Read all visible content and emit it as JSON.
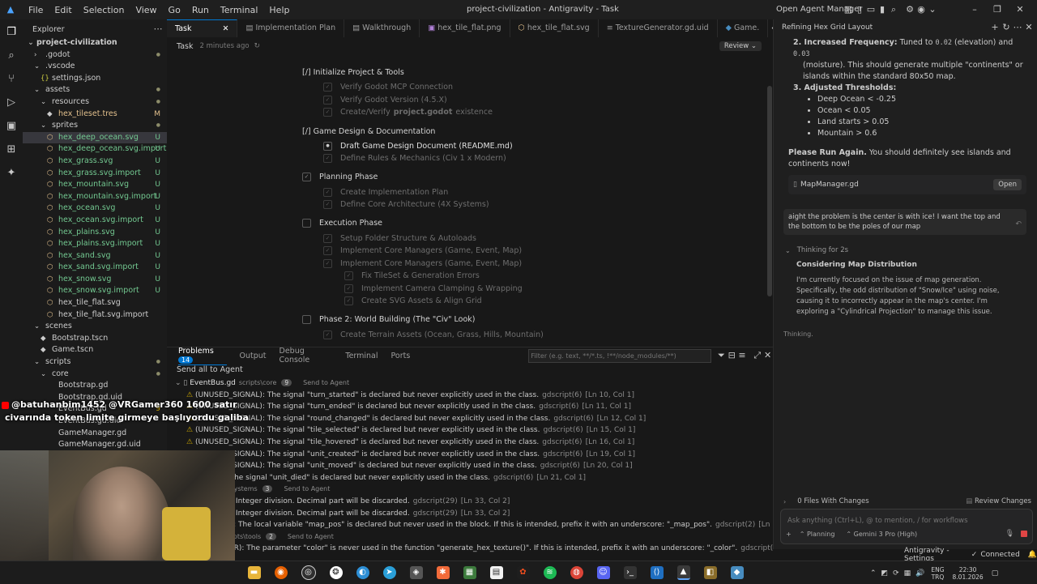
{
  "titlebar": {
    "menu": [
      "File",
      "Edit",
      "Selection",
      "View",
      "Go",
      "Run",
      "Terminal",
      "Help"
    ],
    "title": "project-civilization - Antigravity - Task",
    "open_agent_manager": "Open Agent Manager"
  },
  "sidebar": {
    "header": "Explorer",
    "root": "project-civilization",
    "items": [
      {
        "label": ".godot",
        "depth": 1,
        "kind": "folder-closed",
        "marker": "dot"
      },
      {
        "label": ".vscode",
        "depth": 1,
        "kind": "folder-open",
        "marker": ""
      },
      {
        "label": "settings.json",
        "depth": 2,
        "kind": "json",
        "marker": ""
      },
      {
        "label": "assets",
        "depth": 1,
        "kind": "folder-open",
        "marker": "dot"
      },
      {
        "label": "resources",
        "depth": 2,
        "kind": "folder-open",
        "marker": "dot"
      },
      {
        "label": "hex_tileset.tres",
        "depth": 3,
        "kind": "res",
        "marker": "M"
      },
      {
        "label": "sprites",
        "depth": 2,
        "kind": "folder-open",
        "marker": "dot"
      },
      {
        "label": "hex_deep_ocean.svg",
        "depth": 3,
        "kind": "svg",
        "marker": "U",
        "selected": true
      },
      {
        "label": "hex_deep_ocean.svg.import",
        "depth": 3,
        "kind": "svg",
        "marker": "U"
      },
      {
        "label": "hex_grass.svg",
        "depth": 3,
        "kind": "svg",
        "marker": "U"
      },
      {
        "label": "hex_grass.svg.import",
        "depth": 3,
        "kind": "svg",
        "marker": "U"
      },
      {
        "label": "hex_mountain.svg",
        "depth": 3,
        "kind": "svg",
        "marker": "U"
      },
      {
        "label": "hex_mountain.svg.import",
        "depth": 3,
        "kind": "svg",
        "marker": "U"
      },
      {
        "label": "hex_ocean.svg",
        "depth": 3,
        "kind": "svg",
        "marker": "U"
      },
      {
        "label": "hex_ocean.svg.import",
        "depth": 3,
        "kind": "svg",
        "marker": "U"
      },
      {
        "label": "hex_plains.svg",
        "depth": 3,
        "kind": "svg",
        "marker": "U"
      },
      {
        "label": "hex_plains.svg.import",
        "depth": 3,
        "kind": "svg",
        "marker": "U"
      },
      {
        "label": "hex_sand.svg",
        "depth": 3,
        "kind": "svg",
        "marker": "U"
      },
      {
        "label": "hex_sand.svg.import",
        "depth": 3,
        "kind": "svg",
        "marker": "U"
      },
      {
        "label": "hex_snow.svg",
        "depth": 3,
        "kind": "svg",
        "marker": "U"
      },
      {
        "label": "hex_snow.svg.import",
        "depth": 3,
        "kind": "svg",
        "marker": "U"
      },
      {
        "label": "hex_tile_flat.svg",
        "depth": 3,
        "kind": "svg",
        "marker": ""
      },
      {
        "label": "hex_tile_flat.svg.import",
        "depth": 3,
        "kind": "svg",
        "marker": ""
      },
      {
        "label": "scenes",
        "depth": 1,
        "kind": "folder-open",
        "marker": ""
      },
      {
        "label": "Bootstrap.tscn",
        "depth": 2,
        "kind": "scene",
        "marker": ""
      },
      {
        "label": "Game.tscn",
        "depth": 2,
        "kind": "scene",
        "marker": ""
      },
      {
        "label": "scripts",
        "depth": 1,
        "kind": "folder-open",
        "marker": "dot"
      },
      {
        "label": "core",
        "depth": 2,
        "kind": "folder-open",
        "marker": "dot"
      },
      {
        "label": "Bootstrap.gd",
        "depth": 3,
        "kind": "gd",
        "marker": ""
      },
      {
        "label": "Bootstrap.gd.uid",
        "depth": 3,
        "kind": "gd",
        "marker": ""
      },
      {
        "label": "EventBus.gd",
        "depth": 3,
        "kind": "gd",
        "marker": "9"
      },
      {
        "label": "EventBus.gd.uid",
        "depth": 3,
        "kind": "gd",
        "marker": ""
      },
      {
        "label": "GameManager.gd",
        "depth": 3,
        "kind": "gd",
        "marker": ""
      },
      {
        "label": "GameManager.gd.uid",
        "depth": 3,
        "kind": "gd",
        "marker": ""
      }
    ]
  },
  "tabs": [
    {
      "label": "Task",
      "active": true
    },
    {
      "label": "Implementation Plan"
    },
    {
      "label": "Walkthrough"
    },
    {
      "label": "hex_tile_flat.png"
    },
    {
      "label": "hex_tile_flat.svg"
    },
    {
      "label": "TextureGenerator.gd.uid"
    },
    {
      "label": "Game."
    }
  ],
  "task_header": {
    "title": "Task",
    "time": "2 minutes ago",
    "review": "Review"
  },
  "tasks": [
    {
      "type": "section",
      "label": "[/] Initialize Project & Tools",
      "indent": 0
    },
    {
      "type": "item",
      "label": "Verify Godot MCP Connection",
      "indent": 1,
      "state": "done"
    },
    {
      "type": "item",
      "label": "Verify Godot Version (4.5.X)",
      "indent": 1,
      "state": "done"
    },
    {
      "type": "item",
      "label": "Create/Verify",
      "label_bold": "project.godot",
      "label_after": "existence",
      "indent": 1,
      "state": "done"
    },
    {
      "type": "section",
      "label": "[/] Game Design & Documentation",
      "indent": 0
    },
    {
      "type": "item",
      "label": "Draft Game Design Document (README.md)",
      "indent": 1,
      "state": "active"
    },
    {
      "type": "item",
      "label": "Define Rules & Mechanics (Civ 1 x Modern)",
      "indent": 1,
      "state": "done"
    },
    {
      "type": "item",
      "label": "Planning Phase",
      "indent": 0,
      "state": "checked"
    },
    {
      "type": "item",
      "label": "Create Implementation Plan",
      "indent": 1,
      "state": "done"
    },
    {
      "type": "item",
      "label": "Define Core Architecture (4X Systems)",
      "indent": 1,
      "state": "done"
    },
    {
      "type": "item",
      "label": "Execution Phase",
      "indent": 0,
      "state": "empty"
    },
    {
      "type": "item",
      "label": "Setup Folder Structure & Autoloads",
      "indent": 1,
      "state": "done"
    },
    {
      "type": "item",
      "label": "Implement Core Managers (Game, Event, Map)",
      "indent": 1,
      "state": "done"
    },
    {
      "type": "item",
      "label": "Implement Core Managers (Game, Event, Map)",
      "indent": 1,
      "state": "done"
    },
    {
      "type": "item",
      "label": "Fix TileSet & Generation Errors",
      "indent": 2,
      "state": "done"
    },
    {
      "type": "item",
      "label": "Implement Camera Clamping & Wrapping",
      "indent": 2,
      "state": "done"
    },
    {
      "type": "item",
      "label": "Create SVG Assets & Align Grid",
      "indent": 2,
      "state": "done"
    },
    {
      "type": "item",
      "label": "Phase 2: World Building (The \"Civ\" Look)",
      "indent": 0,
      "state": "empty"
    },
    {
      "type": "item",
      "label": "Create Terrain Assets (Ocean, Grass, Hills, Mountain)",
      "indent": 1,
      "state": "done"
    }
  ],
  "panel": {
    "tabs": [
      "Problems",
      "Output",
      "Debug Console",
      "Terminal",
      "Ports"
    ],
    "problems_count": "14",
    "filter_placeholder": "Filter (e.g. text, **/*.ts, !**/node_modules/**)",
    "send_all": "Send all to Agent",
    "rows": [
      {
        "type": "file",
        "name": "EventBus.gd",
        "path": "scripts\\core",
        "count": "9",
        "action": "Send to Agent"
      },
      {
        "type": "warn",
        "text": "(UNUSED_SIGNAL): The signal \"turn_started\" is declared but never explicitly used in the class.",
        "src": "gdscript(6)",
        "loc": "[Ln 10, Col 1]"
      },
      {
        "type": "warn",
        "text": "(UNUSED_SIGNAL): The signal \"turn_ended\" is declared but never explicitly used in the class.",
        "src": "gdscript(6)",
        "loc": "[Ln 11, Col 1]"
      },
      {
        "type": "warn",
        "text": "(UNUSED_SIGNAL): The signal \"round_changed\" is declared but never explicitly used in the class.",
        "src": "gdscript(6)",
        "loc": "[Ln 12, Col 1]"
      },
      {
        "type": "warn",
        "text": "(UNUSED_SIGNAL): The signal \"tile_selected\" is declared but never explicitly used in the class.",
        "src": "gdscript(6)",
        "loc": "[Ln 15, Col 1]"
      },
      {
        "type": "warn",
        "text": "(UNUSED_SIGNAL): The signal \"tile_hovered\" is declared but never explicitly used in the class.",
        "src": "gdscript(6)",
        "loc": "[Ln 16, Col 1]"
      },
      {
        "type": "warn",
        "text": "(UNUSED_SIGNAL): The signal \"unit_created\" is declared but never explicitly used in the class.",
        "src": "gdscript(6)",
        "loc": "[Ln 19, Col 1]"
      },
      {
        "type": "warn",
        "text": "(UNUSED_SIGNAL): The signal \"unit_moved\" is declared but never explicitly used in the class.",
        "src": "gdscript(6)",
        "loc": "[Ln 20, Col 1]"
      },
      {
        "type": "warn",
        "text": "SIGNAL): The signal \"unit_died\" is declared but never explicitly used in the class.",
        "src": "gdscript(6)",
        "loc": "[Ln 21, Col 1]"
      },
      {
        "type": "file",
        "name": "r.gd",
        "path": "scripts\\systems",
        "count": "3",
        "action": "Send to Agent"
      },
      {
        "type": "warn",
        "text": "DIVISION): Integer division. Decimal part will be discarded.",
        "src": "gdscript(29)",
        "loc": "[Ln 33, Col 2]"
      },
      {
        "type": "warn",
        "text": "DIVISION): Integer division. Decimal part will be discarded.",
        "src": "gdscript(29)",
        "loc": "[Ln 33, Col 2]"
      },
      {
        "type": "warn",
        "text": "VARIABLE): The local variable \"map_pos\" is declared but never used in the block. If this is intended, prefix it with an underscore: \"_map_pos\".",
        "src": "gdscript(2)",
        "loc": "[Ln 38, Col 2]"
      },
      {
        "type": "file",
        "name": "rator.gd",
        "path": "scripts\\tools",
        "count": "2",
        "action": "Send to Agent"
      },
      {
        "type": "warn",
        "text": "PARAMETER): The parameter \"color\" is never used in the function \"generate_hex_texture()\". If this is intended, prefix it with an underscore: \"_color\".",
        "src": "gdscript(5)",
        "loc": "[Ln 4, Col 1]"
      }
    ]
  },
  "agent": {
    "title": "Refining Hex Grid Layout",
    "item2_bold": "Increased Frequency:",
    "item2_text": " Tuned to ",
    "item2_code1": "0.02",
    "item2_mid": " (elevation) and ",
    "item2_code2": "0.03",
    "item2_text2": "(moisture). This should generate multiple \"continents\" or islands within the standard 80x50 map.",
    "item3_bold": "Adjusted Thresholds:",
    "bullets": [
      "Deep Ocean < -0.25",
      "Ocean < 0.05",
      "Land starts > 0.05",
      "Mountain > 0.6"
    ],
    "please_bold": "Please Run Again.",
    "please_text": " You should definitely see islands and continents now!",
    "file_name": "MapManager.gd",
    "open_btn": "Open",
    "user_msg": "aight the problem is the center is with ice! I want the top and the bottom to be the poles of our map",
    "thinking_toggle": "Thinking for 2s",
    "thinking_title": "Considering Map Distribution",
    "thinking_body": "I'm currently focused on the issue of map generation. Specifically, the odd distribution of \"Snow/Ice\" using noise, causing it to incorrectly appear in the map's center. I'm exploring a \"Cylindrical Projection\" to manage this issue.",
    "status": "Thinking.",
    "files_changed": "0 Files With Changes",
    "review_changes": "Review Changes",
    "input_placeholder": "Ask anything (Ctrl+L), @ to mention, / for workflows",
    "mode": "Planning",
    "model": "Gemini 3 Pro (High)"
  },
  "statusbar": {
    "left": "Antigravity - Settings",
    "right": "Connected"
  },
  "overlay_chat": {
    "user": "@batuhanbim1452",
    "message_1": "@VRGamer360 1600 satır",
    "message_2": "civarında token limite girmeye başlıyordu galiba"
  },
  "taskbar": {
    "lang": "ENG",
    "region": "TRQ",
    "time": "22:30",
    "date": "8.01.2026"
  },
  "colors": {
    "accent": "#0078d4",
    "warning": "#cca700",
    "modified": "#e2c08d",
    "untracked": "#73c991"
  }
}
